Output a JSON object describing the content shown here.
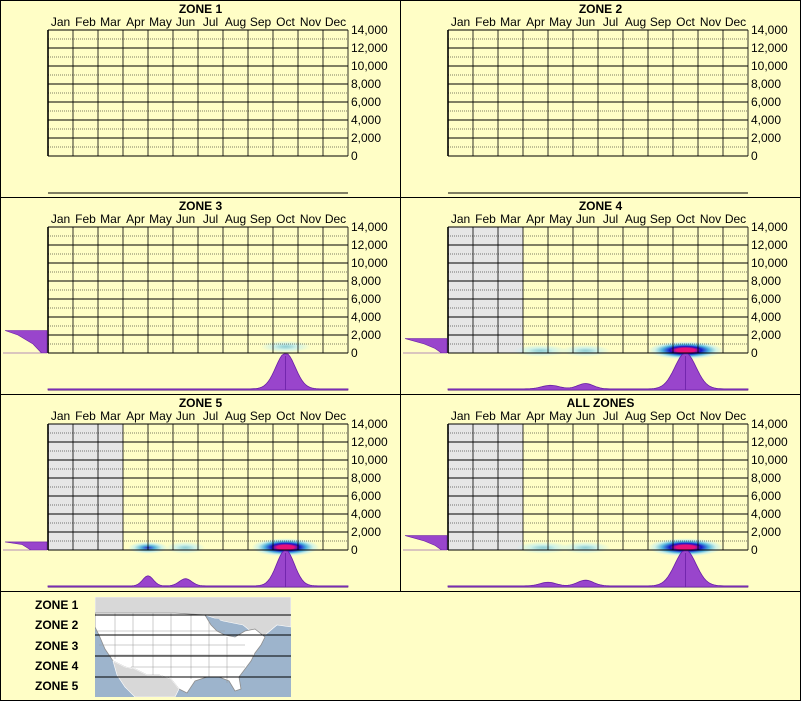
{
  "legend": {
    "zones": [
      "ZONE 1",
      "ZONE 2",
      "ZONE 3",
      "ZONE 4",
      "ZONE 5"
    ]
  },
  "colors": {
    "background": "#fffec6",
    "shading": "#e6e6e6",
    "profile": "#9945cc",
    "profile_edge": "#6a1fa6",
    "heat_low": "#bfeef2",
    "heat_mid": "#3aa8e0",
    "heat_high": "#1414c8",
    "heat_peak": "#e8107a"
  },
  "chart_data": [
    {
      "type": "heatmap",
      "title": "ZONE 1",
      "categories": [
        "Jan",
        "Feb",
        "Mar",
        "Apr",
        "May",
        "Jun",
        "Jul",
        "Aug",
        "Sep",
        "Oct",
        "Nov",
        "Dec"
      ],
      "y_ticks": [
        "14,000",
        "12,000",
        "10,000",
        "8,000",
        "6,000",
        "4,000",
        "2,000",
        "0"
      ],
      "ylim": [
        0,
        14000
      ],
      "shaded_months": [],
      "hot_spots": [],
      "month_profile": [],
      "elevation_profile": []
    },
    {
      "type": "heatmap",
      "title": "ZONE 2",
      "categories": [
        "Jan",
        "Feb",
        "Mar",
        "Apr",
        "May",
        "Jun",
        "Jul",
        "Aug",
        "Sep",
        "Oct",
        "Nov",
        "Dec"
      ],
      "y_ticks": [
        "14,000",
        "12,000",
        "10,000",
        "8,000",
        "6,000",
        "4,000",
        "2,000",
        "0"
      ],
      "ylim": [
        0,
        14000
      ],
      "shaded_months": [],
      "hot_spots": [],
      "month_profile": [],
      "elevation_profile": []
    },
    {
      "type": "heatmap",
      "title": "ZONE 3",
      "categories": [
        "Jan",
        "Feb",
        "Mar",
        "Apr",
        "May",
        "Jun",
        "Jul",
        "Aug",
        "Sep",
        "Oct",
        "Nov",
        "Dec"
      ],
      "y_ticks": [
        "14,000",
        "12,000",
        "10,000",
        "8,000",
        "6,000",
        "4,000",
        "2,000",
        "0"
      ],
      "ylim": [
        0,
        14000
      ],
      "shaded_months": [],
      "hot_spots": [
        {
          "month": 10,
          "elev": 700,
          "intensity": 0.35,
          "spread": 1.0
        }
      ],
      "month_profile": [
        {
          "month": 10.0,
          "height": 1.0,
          "width": 0.55
        }
      ],
      "elevation_profile": [
        [
          0,
          0.15
        ],
        [
          1000,
          0.35
        ],
        [
          2000,
          0.7
        ],
        [
          2500,
          1.0
        ]
      ]
    },
    {
      "type": "heatmap",
      "title": "ZONE 4",
      "categories": [
        "Jan",
        "Feb",
        "Mar",
        "Apr",
        "May",
        "Jun",
        "Jul",
        "Aug",
        "Sep",
        "Oct",
        "Nov",
        "Dec"
      ],
      "y_ticks": [
        "14,000",
        "12,000",
        "10,000",
        "8,000",
        "6,000",
        "4,000",
        "2,000",
        "0"
      ],
      "ylim": [
        0,
        14000
      ],
      "shaded_months": [
        1,
        2,
        3
      ],
      "hot_spots": [
        {
          "month": 4.2,
          "elev": 250,
          "intensity": 0.25,
          "spread": 1.1
        },
        {
          "month": 6.0,
          "elev": 250,
          "intensity": 0.28,
          "spread": 1.0
        },
        {
          "month": 10.0,
          "elev": 300,
          "intensity": 1.0,
          "spread": 1.0
        }
      ],
      "month_profile": [
        {
          "month": 4.6,
          "height": 0.1,
          "width": 0.5
        },
        {
          "month": 6.0,
          "height": 0.15,
          "width": 0.45
        },
        {
          "month": 10.0,
          "height": 1.0,
          "width": 0.6
        }
      ],
      "elevation_profile": [
        [
          0,
          0.15
        ],
        [
          500,
          0.3
        ],
        [
          1000,
          0.55
        ],
        [
          1600,
          1.0
        ]
      ]
    },
    {
      "type": "heatmap",
      "title": "ZONE 5",
      "categories": [
        "Jan",
        "Feb",
        "Mar",
        "Apr",
        "May",
        "Jun",
        "Jul",
        "Aug",
        "Sep",
        "Oct",
        "Nov",
        "Dec"
      ],
      "y_ticks": [
        "14,000",
        "12,000",
        "10,000",
        "8,000",
        "6,000",
        "4,000",
        "2,000",
        "0"
      ],
      "ylim": [
        0,
        14000
      ],
      "shaded_months": [
        1,
        2,
        3
      ],
      "hot_spots": [
        {
          "month": 4.5,
          "elev": 250,
          "intensity": 0.55,
          "spread": 0.8
        },
        {
          "month": 6.0,
          "elev": 250,
          "intensity": 0.45,
          "spread": 0.8
        },
        {
          "month": 10.0,
          "elev": 300,
          "intensity": 1.0,
          "spread": 0.9
        }
      ],
      "month_profile": [
        {
          "month": 4.5,
          "height": 0.28,
          "width": 0.3
        },
        {
          "month": 6.0,
          "height": 0.2,
          "width": 0.35
        },
        {
          "month": 10.0,
          "height": 1.0,
          "width": 0.5
        }
      ],
      "elevation_profile": [
        [
          0,
          0.4
        ],
        [
          600,
          0.6
        ],
        [
          900,
          1.0
        ]
      ]
    },
    {
      "type": "heatmap",
      "title": "ALL ZONES",
      "categories": [
        "Jan",
        "Feb",
        "Mar",
        "Apr",
        "May",
        "Jun",
        "Jul",
        "Aug",
        "Sep",
        "Oct",
        "Nov",
        "Dec"
      ],
      "y_ticks": [
        "14,000",
        "12,000",
        "10,000",
        "8,000",
        "6,000",
        "4,000",
        "2,000",
        "0"
      ],
      "ylim": [
        0,
        14000
      ],
      "shaded_months": [
        1,
        2,
        3
      ],
      "hot_spots": [
        {
          "month": 4.3,
          "elev": 250,
          "intensity": 0.3,
          "spread": 1.1
        },
        {
          "month": 6.0,
          "elev": 250,
          "intensity": 0.3,
          "spread": 1.0
        },
        {
          "month": 10.0,
          "elev": 300,
          "intensity": 1.0,
          "spread": 1.0
        }
      ],
      "month_profile": [
        {
          "month": 4.5,
          "height": 0.1,
          "width": 0.45
        },
        {
          "month": 6.0,
          "height": 0.16,
          "width": 0.45
        },
        {
          "month": 10.0,
          "height": 1.0,
          "width": 0.6
        }
      ],
      "elevation_profile": [
        [
          0,
          0.15
        ],
        [
          500,
          0.3
        ],
        [
          1000,
          0.55
        ],
        [
          1600,
          1.0
        ]
      ]
    }
  ]
}
